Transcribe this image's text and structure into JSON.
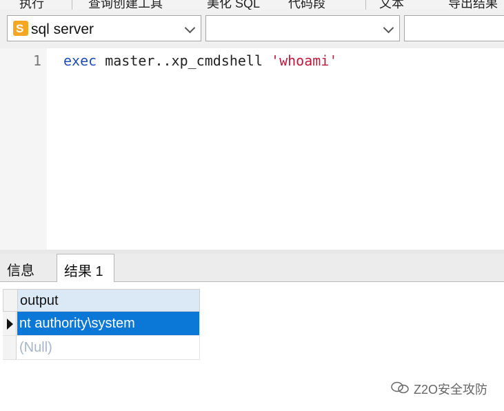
{
  "toolbar": {
    "items": [
      "执行",
      "查询创建工具",
      "美化 SQL",
      "代码段",
      "文本",
      "导出结果"
    ]
  },
  "connection_selector": {
    "value": "sql server"
  },
  "database_selector": {
    "value": ""
  },
  "schema_selector": {
    "value": ""
  },
  "editor": {
    "line_number": "1",
    "code": {
      "keyword": "exec",
      "target": " master..xp_cmdshell ",
      "string": "'whoami'"
    }
  },
  "result_tabs": [
    "信息",
    "结果 1"
  ],
  "result_grid": {
    "column": "output",
    "rows": [
      "nt authority\\system",
      "(Null)"
    ]
  },
  "watermark": "Z2O安全攻防",
  "colors": {
    "keyword": "#1f4fb5",
    "string": "#c0193a",
    "selected_row": "#0b78d7",
    "header": "#dbe9f7"
  }
}
